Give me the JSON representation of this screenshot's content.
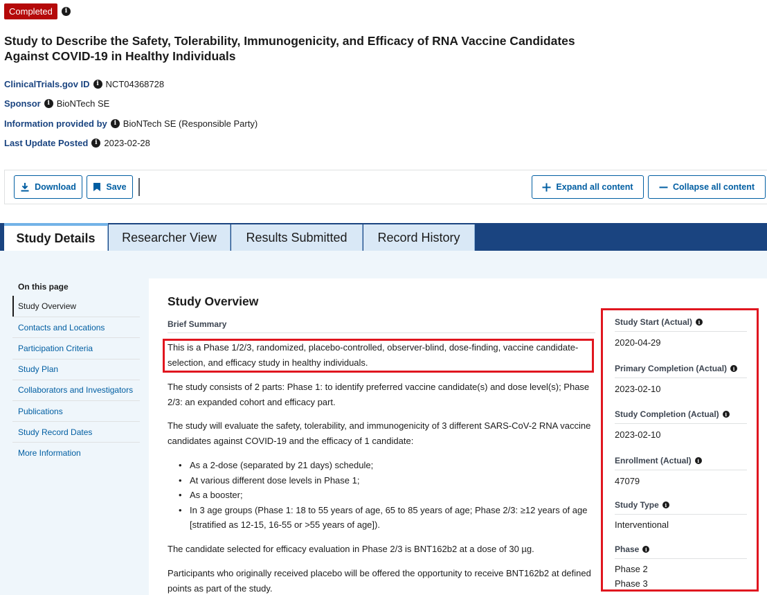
{
  "status": {
    "badge": "Completed"
  },
  "study": {
    "title_line1": "Study to Describe the Safety, Tolerability, Immunogenicity, and Efficacy of RNA Vaccine Candidates",
    "title_line2": "Against COVID-19 in Healthy Individuals"
  },
  "meta": {
    "id_label": "ClinicalTrials.gov ID",
    "id_value": "NCT04368728",
    "sponsor_label": "Sponsor",
    "sponsor_value": "BioNTech SE",
    "provided_label": "Information provided by",
    "provided_value": "BioNTech SE (Responsible Party)",
    "update_label": "Last Update Posted",
    "update_value": "2023-02-28"
  },
  "toolbar": {
    "download": "Download",
    "save": "Save",
    "expand": "Expand all content",
    "collapse": "Collapse all content"
  },
  "tabs": [
    "Study Details",
    "Researcher View",
    "Results Submitted",
    "Record History"
  ],
  "sidenav": {
    "heading": "On this page",
    "items": [
      "Study Overview",
      "Contacts and Locations",
      "Participation Criteria",
      "Study Plan",
      "Collaborators and Investigators",
      "Publications",
      "Study Record Dates",
      "More Information"
    ]
  },
  "overview": {
    "title": "Study Overview",
    "brief_label": "Brief Summary",
    "p1": "This is a Phase 1/2/3, randomized, placebo-controlled, observer-blind, dose-finding, vaccine candidate-selection, and efficacy study in healthy individuals.",
    "p2": "The study consists of 2 parts: Phase 1: to identify preferred vaccine candidate(s) and dose level(s); Phase 2/3: an expanded cohort and efficacy part.",
    "p3": "The study will evaluate the safety, tolerability, and immunogenicity of 3 different SARS-CoV-2 RNA vaccine candidates against COVID-19 and the efficacy of 1 candidate:",
    "bullets": [
      "As a 2-dose (separated by 21 days) schedule;",
      "At various different dose levels in Phase 1;",
      "As a booster;",
      "In 3 age groups (Phase 1: 18 to 55 years of age, 65 to 85 years of age; Phase 2/3: ≥12 years of age [stratified as 12-15, 16-55 or >55 years of age])."
    ],
    "p4": "The candidate selected for efficacy evaluation in Phase 2/3 is BNT162b2 at a dose of 30 µg.",
    "p5": "Participants who originally received placebo will be offered the opportunity to receive BNT162b2 at defined points as part of the study."
  },
  "facts": {
    "start_label": "Study Start (Actual)",
    "start_value": "2020-04-29",
    "primary_label": "Primary Completion (Actual)",
    "primary_value": "2023-02-10",
    "completion_label": "Study Completion (Actual)",
    "completion_value": "2023-02-10",
    "enrollment_label": "Enrollment (Actual)",
    "enrollment_value": "47079",
    "type_label": "Study Type",
    "type_value": "Interventional",
    "phase_label": "Phase",
    "phase_values": [
      "Phase 2",
      "Phase 3"
    ]
  },
  "colors": {
    "badge": "#b50909",
    "link": "#005ea2",
    "tabbar": "#1a4480",
    "highlight": "#e0161f"
  }
}
